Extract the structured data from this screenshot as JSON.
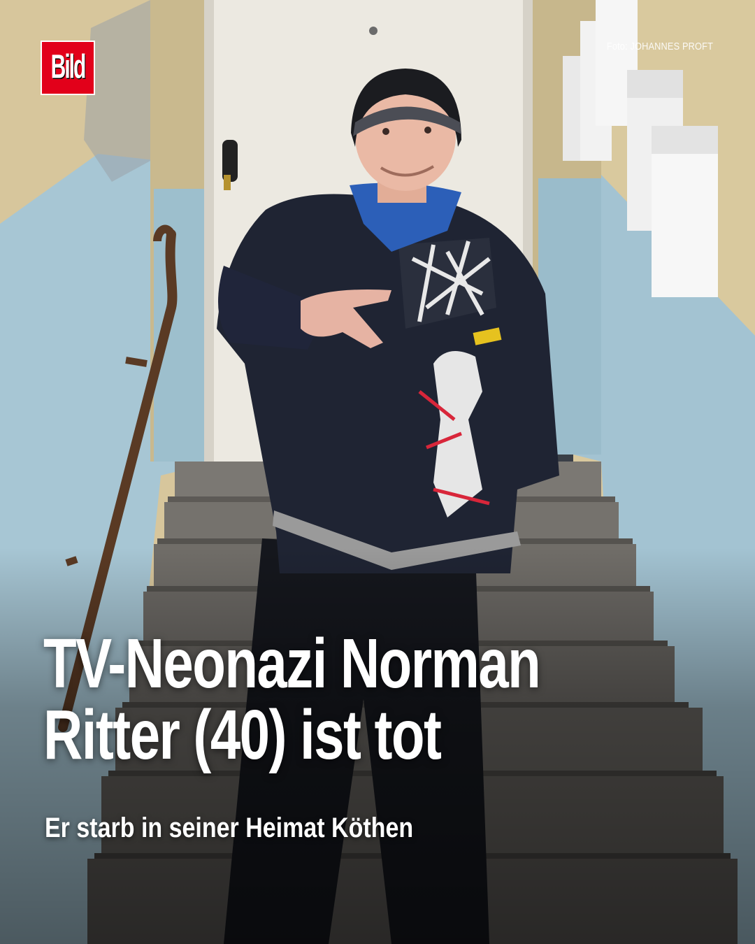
{
  "brand": {
    "logo_text": "Bild",
    "accent": "#e2001a"
  },
  "credit": "Foto: JOHANNES PROFT",
  "headline": {
    "line1": "TV-Neonazi Norman",
    "line2": "Ritter (40) ist tot"
  },
  "subline": "Er starb in seiner Heimat Köthen",
  "colors": {
    "wall_yellow": "#d9c79c",
    "wall_blue": "#a9c8d6",
    "door": "#eeebe3",
    "jacket": "#1e2330",
    "stairs": "#6e6c68"
  }
}
